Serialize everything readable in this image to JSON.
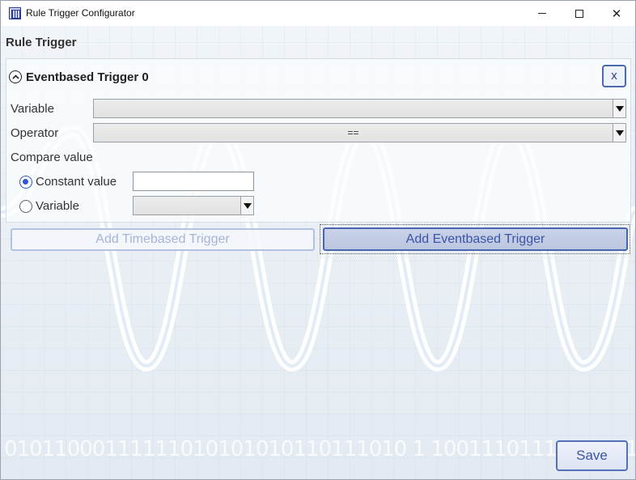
{
  "window": {
    "title": "Rule Trigger Configurator",
    "icon": "app-chip-icon",
    "controls": [
      "minimize-icon",
      "maximize-icon",
      "close-icon"
    ],
    "close_glyph": "✕"
  },
  "section": {
    "title": "Rule Trigger"
  },
  "trigger": {
    "title": "Eventbased Trigger 0",
    "collapse_icon": "chevron-up-circle-icon",
    "remove_label": "x",
    "variable_label": "Variable",
    "variable_value": "",
    "operator_label": "Operator",
    "operator_value": "==",
    "compare_label": "Compare value",
    "constant_option": "Constant value",
    "constant_selected": true,
    "constant_value": "",
    "variable_option": "Variable",
    "variable_option_value": ""
  },
  "buttons": {
    "add_timebased": "Add Timebased Trigger",
    "add_eventbased": "Add Eventbased Trigger",
    "save": "Save"
  },
  "background": {
    "binary_text": "01011000111111010101010110111010 1 10011101110101 01"
  },
  "colors": {
    "accent": "#2d57d0",
    "button_border": "#4a65b0",
    "disabled_text": "#a7b4d9"
  }
}
